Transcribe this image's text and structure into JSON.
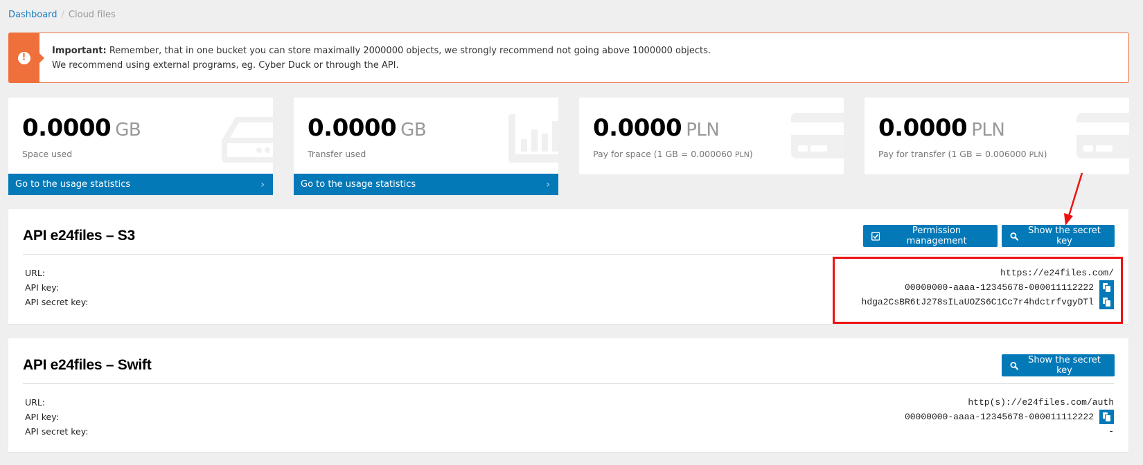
{
  "breadcrumb": {
    "items": [
      {
        "label": "Dashboard",
        "link": true
      },
      {
        "label": "Cloud files",
        "link": false
      }
    ],
    "separator": "/"
  },
  "alert": {
    "icon": "exclamation-circle-icon",
    "strong": "Important:",
    "line1": " Remember, that in one bucket you can store maximally 2000000 objects, we strongly recommend not going above 1000000 objects.",
    "line2": "We recommend using external programs, eg. Cyber Duck or through the API.",
    "color": "#f0703c"
  },
  "stats": [
    {
      "value": "0.0000",
      "unit": "GB",
      "label": "Space used",
      "icon": "hard-drive-icon",
      "link": "Go to the usage statistics"
    },
    {
      "value": "0.0000",
      "unit": "GB",
      "label": "Transfer used",
      "icon": "bar-chart-icon",
      "link": "Go to the usage statistics"
    },
    {
      "value": "0.0000",
      "unit": "PLN",
      "label": "Pay for space (1 GB = 0.000060 ",
      "label_unit": "PLN",
      "label_end": ")",
      "icon": "credit-card-icon"
    },
    {
      "value": "0.0000",
      "unit": "PLN",
      "label": "Pay for transfer (1 GB = 0.006000 ",
      "label_unit": "PLN",
      "label_end": ")",
      "icon": "credit-card-icon"
    }
  ],
  "s3": {
    "title": "API e24files – S3",
    "buttons": {
      "permission": "Permission management",
      "show_secret": "Show the secret key"
    },
    "labels": {
      "url": "URL:",
      "api_key": "API key:",
      "secret": "API secret key:"
    },
    "values": {
      "url": "https://e24files.com/",
      "api_key": "00000000-aaaa-12345678-000011112222",
      "secret": "hdga2CsBR6tJ278sILaUOZS6C1Cc7r4hdctrfvgyDTl"
    }
  },
  "swift": {
    "title": "API e24files – Swift",
    "buttons": {
      "show_secret": "Show the secret key"
    },
    "labels": {
      "url": "URL:",
      "api_key": "API key:",
      "secret": "API secret key:"
    },
    "values": {
      "url": "http(s)://e24files.com/auth",
      "api_key": "00000000-aaaa-12345678-000011112222",
      "secret": "-"
    }
  },
  "colors": {
    "primary": "#0479b8",
    "alert": "#f0703c",
    "annotation": "#ee1111",
    "background": "#efefef"
  }
}
